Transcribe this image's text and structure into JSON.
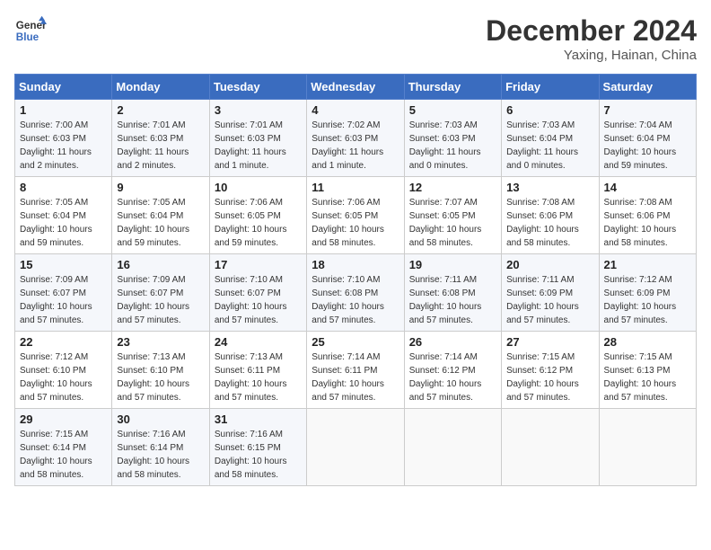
{
  "header": {
    "logo_line1": "General",
    "logo_line2": "Blue",
    "month": "December 2024",
    "location": "Yaxing, Hainan, China"
  },
  "weekdays": [
    "Sunday",
    "Monday",
    "Tuesday",
    "Wednesday",
    "Thursday",
    "Friday",
    "Saturday"
  ],
  "weeks": [
    [
      {
        "day": "1",
        "sunrise": "7:00 AM",
        "sunset": "6:03 PM",
        "daylight": "11 hours and 2 minutes."
      },
      {
        "day": "2",
        "sunrise": "7:01 AM",
        "sunset": "6:03 PM",
        "daylight": "11 hours and 2 minutes."
      },
      {
        "day": "3",
        "sunrise": "7:01 AM",
        "sunset": "6:03 PM",
        "daylight": "11 hours and 1 minute."
      },
      {
        "day": "4",
        "sunrise": "7:02 AM",
        "sunset": "6:03 PM",
        "daylight": "11 hours and 1 minute."
      },
      {
        "day": "5",
        "sunrise": "7:03 AM",
        "sunset": "6:03 PM",
        "daylight": "11 hours and 0 minutes."
      },
      {
        "day": "6",
        "sunrise": "7:03 AM",
        "sunset": "6:04 PM",
        "daylight": "11 hours and 0 minutes."
      },
      {
        "day": "7",
        "sunrise": "7:04 AM",
        "sunset": "6:04 PM",
        "daylight": "10 hours and 59 minutes."
      }
    ],
    [
      {
        "day": "8",
        "sunrise": "7:05 AM",
        "sunset": "6:04 PM",
        "daylight": "10 hours and 59 minutes."
      },
      {
        "day": "9",
        "sunrise": "7:05 AM",
        "sunset": "6:04 PM",
        "daylight": "10 hours and 59 minutes."
      },
      {
        "day": "10",
        "sunrise": "7:06 AM",
        "sunset": "6:05 PM",
        "daylight": "10 hours and 59 minutes."
      },
      {
        "day": "11",
        "sunrise": "7:06 AM",
        "sunset": "6:05 PM",
        "daylight": "10 hours and 58 minutes."
      },
      {
        "day": "12",
        "sunrise": "7:07 AM",
        "sunset": "6:05 PM",
        "daylight": "10 hours and 58 minutes."
      },
      {
        "day": "13",
        "sunrise": "7:08 AM",
        "sunset": "6:06 PM",
        "daylight": "10 hours and 58 minutes."
      },
      {
        "day": "14",
        "sunrise": "7:08 AM",
        "sunset": "6:06 PM",
        "daylight": "10 hours and 58 minutes."
      }
    ],
    [
      {
        "day": "15",
        "sunrise": "7:09 AM",
        "sunset": "6:07 PM",
        "daylight": "10 hours and 57 minutes."
      },
      {
        "day": "16",
        "sunrise": "7:09 AM",
        "sunset": "6:07 PM",
        "daylight": "10 hours and 57 minutes."
      },
      {
        "day": "17",
        "sunrise": "7:10 AM",
        "sunset": "6:07 PM",
        "daylight": "10 hours and 57 minutes."
      },
      {
        "day": "18",
        "sunrise": "7:10 AM",
        "sunset": "6:08 PM",
        "daylight": "10 hours and 57 minutes."
      },
      {
        "day": "19",
        "sunrise": "7:11 AM",
        "sunset": "6:08 PM",
        "daylight": "10 hours and 57 minutes."
      },
      {
        "day": "20",
        "sunrise": "7:11 AM",
        "sunset": "6:09 PM",
        "daylight": "10 hours and 57 minutes."
      },
      {
        "day": "21",
        "sunrise": "7:12 AM",
        "sunset": "6:09 PM",
        "daylight": "10 hours and 57 minutes."
      }
    ],
    [
      {
        "day": "22",
        "sunrise": "7:12 AM",
        "sunset": "6:10 PM",
        "daylight": "10 hours and 57 minutes."
      },
      {
        "day": "23",
        "sunrise": "7:13 AM",
        "sunset": "6:10 PM",
        "daylight": "10 hours and 57 minutes."
      },
      {
        "day": "24",
        "sunrise": "7:13 AM",
        "sunset": "6:11 PM",
        "daylight": "10 hours and 57 minutes."
      },
      {
        "day": "25",
        "sunrise": "7:14 AM",
        "sunset": "6:11 PM",
        "daylight": "10 hours and 57 minutes."
      },
      {
        "day": "26",
        "sunrise": "7:14 AM",
        "sunset": "6:12 PM",
        "daylight": "10 hours and 57 minutes."
      },
      {
        "day": "27",
        "sunrise": "7:15 AM",
        "sunset": "6:12 PM",
        "daylight": "10 hours and 57 minutes."
      },
      {
        "day": "28",
        "sunrise": "7:15 AM",
        "sunset": "6:13 PM",
        "daylight": "10 hours and 57 minutes."
      }
    ],
    [
      {
        "day": "29",
        "sunrise": "7:15 AM",
        "sunset": "6:14 PM",
        "daylight": "10 hours and 58 minutes."
      },
      {
        "day": "30",
        "sunrise": "7:16 AM",
        "sunset": "6:14 PM",
        "daylight": "10 hours and 58 minutes."
      },
      {
        "day": "31",
        "sunrise": "7:16 AM",
        "sunset": "6:15 PM",
        "daylight": "10 hours and 58 minutes."
      },
      null,
      null,
      null,
      null
    ]
  ]
}
